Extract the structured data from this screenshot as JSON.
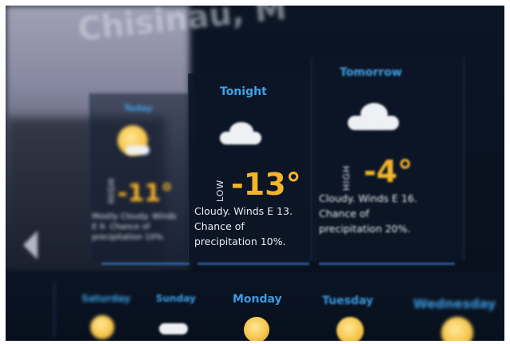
{
  "city_title": "Chisinau, M",
  "nav": {
    "back_arrow": "chevron-left-icon"
  },
  "panels": {
    "today": {
      "period": "Today",
      "label": "HIGH",
      "temp": "-11°",
      "icon": "partly-cloudy-sun-icon",
      "desc": "Mostly Cloudy. Winds\nE 9. Chance of\nprecipitation 10%."
    },
    "tonight": {
      "period": "Tonight",
      "label": "LOW",
      "temp": "-13°",
      "icon": "cloud-icon",
      "desc": "Cloudy.  Winds E 13.\nChance of\nprecipitation 10%."
    },
    "tomorrow": {
      "period": "Tomorrow",
      "label": "HIGH",
      "temp": "-4°",
      "icon": "cloud-icon",
      "desc": "Cloudy.  Winds E 16.\nChance of\nprecipitation 20%."
    }
  },
  "days": [
    {
      "name": "Saturday",
      "icon": "partly-cloudy-sun-icon"
    },
    {
      "name": "Sunday",
      "icon": "cloud-icon"
    },
    {
      "name": "Monday",
      "icon": "partly-cloudy-sun-icon"
    },
    {
      "name": "Tuesday",
      "icon": "partly-cloudy-sun-icon"
    },
    {
      "name": "Wednesday",
      "icon": "partly-cloudy-sun-icon"
    }
  ],
  "colors": {
    "accent_blue": "#3fa3e8",
    "temperature": "#f3b42b",
    "text": "#e9ecf2",
    "background": "#0b1524"
  }
}
